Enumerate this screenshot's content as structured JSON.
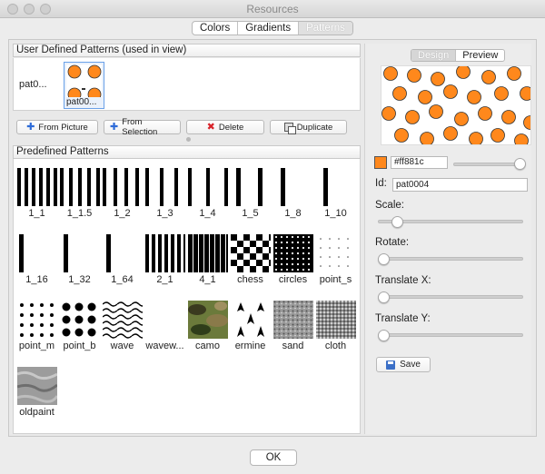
{
  "window": {
    "title": "Resources"
  },
  "tabs": [
    {
      "label": "Colors",
      "selected": false
    },
    {
      "label": "Gradients",
      "selected": false
    },
    {
      "label": "Patterns",
      "selected": true
    }
  ],
  "user_section": {
    "header": "User Defined Patterns (used in view)",
    "items": [
      {
        "label": "pat0...",
        "selected": false
      },
      {
        "label": "pat00...",
        "selected": true
      }
    ]
  },
  "buttons": {
    "from_picture": "From Picture",
    "from_selection": "From Selection",
    "delete": "Delete",
    "duplicate": "Duplicate"
  },
  "predefined": {
    "header": "Predefined Patterns",
    "items": [
      "1_1",
      "1_1.5",
      "1_2",
      "1_3",
      "1_4",
      "1_5",
      "1_8",
      "1_10",
      "1_16",
      "1_32",
      "1_64",
      "2_1",
      "4_1",
      "chess",
      "circles",
      "point_s",
      "point_m",
      "point_b",
      "wave",
      "wavew...",
      "camo",
      "ermine",
      "sand",
      "cloth",
      "oldpaint"
    ]
  },
  "detail": {
    "tabs": [
      {
        "label": "Design",
        "selected": false
      },
      {
        "label": "Preview",
        "selected": true
      }
    ],
    "color_hex": "#ff881c",
    "swatch_color": "#ff881c",
    "id_label": "Id:",
    "id_value": "pat0004",
    "scale_label": "Scale:",
    "rotate_label": "Rotate:",
    "translate_x_label": "Translate X:",
    "translate_y_label": "Translate Y:",
    "save_label": "Save",
    "color_slider": 1.0,
    "scale": 0.1,
    "rotate": 0.0,
    "translate_x": 0.0,
    "translate_y": 0.0
  },
  "ok_label": "OK",
  "colors": {
    "accent_orange": "#ff881c",
    "blue": "#2d6bd8",
    "red": "#d8232a"
  }
}
